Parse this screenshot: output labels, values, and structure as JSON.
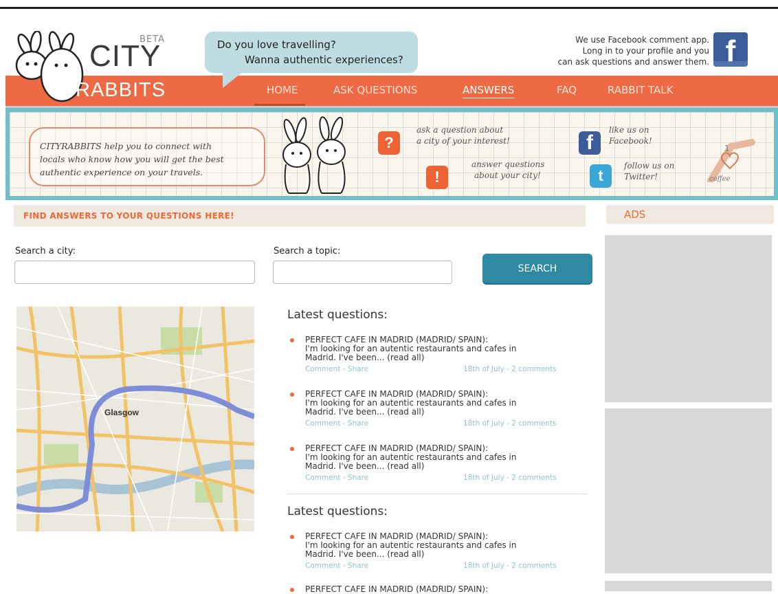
{
  "header": {
    "logo_beta": "BETA",
    "logo_city": "CITY",
    "logo_rabbits": "RABBITS",
    "bubble_line1": "Do you love travelling?",
    "bubble_line2": "Wanna authentic experiences?",
    "fb_note_line1": "We use Facebook comment app.",
    "fb_note_line2": "Long in to your profile and you",
    "fb_note_line3": "can ask questions and answer them.",
    "fb_icon": "facebook-icon"
  },
  "nav": {
    "home": "HOME",
    "ask": "ASK QUESTIONS",
    "answers": "ANSWERS",
    "faq": "FAQ",
    "talk": "RABBIT TALK"
  },
  "banner": {
    "intro_line1": "CITYRABBITS help you to connect with",
    "intro_line2": "locals who know how you will get the best",
    "intro_line3": "authentic experience on your travels.",
    "ask_line1": "ask a question about",
    "ask_line2": "a city of your interest!",
    "answer_line1": "answer questions",
    "answer_line2": "about your city!",
    "fb_line1": "like us on",
    "fb_line2": "Facebook!",
    "tw_line1": "follow us on",
    "tw_line2": "Twitter!",
    "coffee_count": "1",
    "coffee_label": "coffee"
  },
  "search": {
    "bar_title": "FIND ANSWERS TO YOUR QUESTIONS HERE!",
    "city_label": "Search a city:",
    "city_value": "",
    "topic_label": "Search a topic:",
    "topic_value": "",
    "button": "SEARCH"
  },
  "ads": {
    "title": "ADS"
  },
  "map": {
    "city_label": "Glasgow"
  },
  "latest1": {
    "title": "Latest questions:",
    "items": [
      {
        "title": "PERFECT CAFE IN MADRID (MADRID/ SPAIN):",
        "body1": "I'm looking for an autentic restaurants and cafes in",
        "body2": "Madrid. I've been... (read all)",
        "actions": "Comment - Share",
        "date": "18th of July - 2 comments"
      },
      {
        "title": "PERFECT CAFE IN MADRID (MADRID/ SPAIN):",
        "body1": "I'm looking for an autentic restaurants and cafes in",
        "body2": "Madrid. I've been... (read all)",
        "actions": "Comment - Share",
        "date": "18th of July - 2 comments"
      },
      {
        "title": "PERFECT CAFE IN MADRID (MADRID/ SPAIN):",
        "body1": "I'm looking for an autentic restaurants and cafes in",
        "body2": "Madrid. I've been... (read all)",
        "actions": "Comment - Share",
        "date": "18th of July - 2 comments"
      }
    ]
  },
  "latest2": {
    "title": "Latest questions:",
    "items": [
      {
        "title": "PERFECT CAFE IN MADRID (MADRID/ SPAIN):",
        "body1": "I'm looking for an autentic restaurants and cafes in",
        "body2": "Madrid. I've been... (read all)",
        "actions": "Comment - Share",
        "date": "18th of July - 2 comments"
      },
      {
        "title": "PERFECT CAFE IN MADRID (MADRID/ SPAIN):"
      }
    ]
  },
  "colors": {
    "brand_orange": "#ee6a44",
    "teal": "#2e8aa3",
    "link_blue": "#8fc3d4"
  }
}
